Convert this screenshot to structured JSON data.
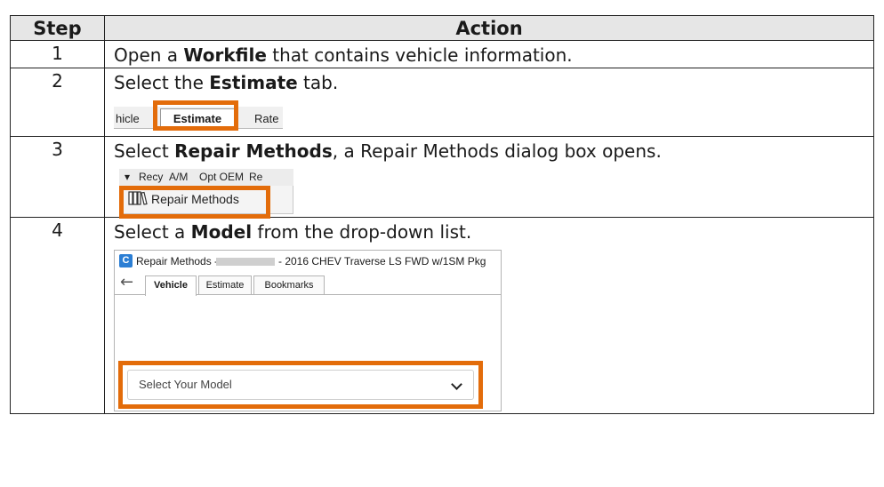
{
  "headers": {
    "step": "Step",
    "action": "Action"
  },
  "steps": [
    {
      "num": "1",
      "pre": "Open a ",
      "bold": "Workfile",
      "post": " that contains vehicle information."
    },
    {
      "num": "2",
      "pre": "Select the ",
      "bold": "Estimate",
      "post": " tab."
    },
    {
      "num": "3",
      "pre": "Select ",
      "bold": "Repair Methods",
      "post": ", a Repair Methods dialog box opens."
    },
    {
      "num": "4",
      "pre": "Select a ",
      "bold": "Model",
      "post": " from the drop-down list."
    }
  ],
  "tabstrip": {
    "left_partial": "hicle",
    "active": "Estimate",
    "right_partial": "Rate"
  },
  "menu": {
    "arrow": "▾",
    "items": [
      "Recy",
      "A/M",
      "Opt OEM",
      "Re"
    ],
    "dropdown_item": "Repair Methods"
  },
  "dialog": {
    "app_icon_letter": "C",
    "title_prefix": "Repair Methods -",
    "title_suffix": "- 2016 CHEV Traverse LS FWD w/1SM Pkg",
    "tabs": [
      "Vehicle",
      "Estimate",
      "Bookmarks"
    ],
    "select_placeholder": "Select Your Model"
  },
  "colors": {
    "highlight": "#e36c0a",
    "header_bg": "#e6e6e6"
  }
}
